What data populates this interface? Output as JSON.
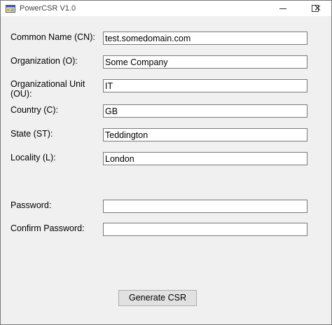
{
  "window": {
    "title": "PowerCSR V1.0"
  },
  "form": {
    "common_name_label": "Common Name (CN):",
    "common_name_value": "test.somedomain.com",
    "organization_label": "Organization (O):",
    "organization_value": "Some Company",
    "org_unit_label": "Organizational Unit (OU):",
    "org_unit_value": "IT",
    "country_label": "Country (C):",
    "country_value": "GB",
    "state_label": "State (ST):",
    "state_value": "Teddington",
    "locality_label": "Locality (L):",
    "locality_value": "London",
    "password_label": "Password:",
    "password_value": "",
    "confirm_password_label": "Confirm Password:",
    "confirm_password_value": ""
  },
  "actions": {
    "generate_label": "Generate CSR"
  },
  "icons": {
    "app": "app-icon",
    "minimize": "minimize-icon",
    "maximize": "maximize-icon",
    "close": "close-icon"
  }
}
